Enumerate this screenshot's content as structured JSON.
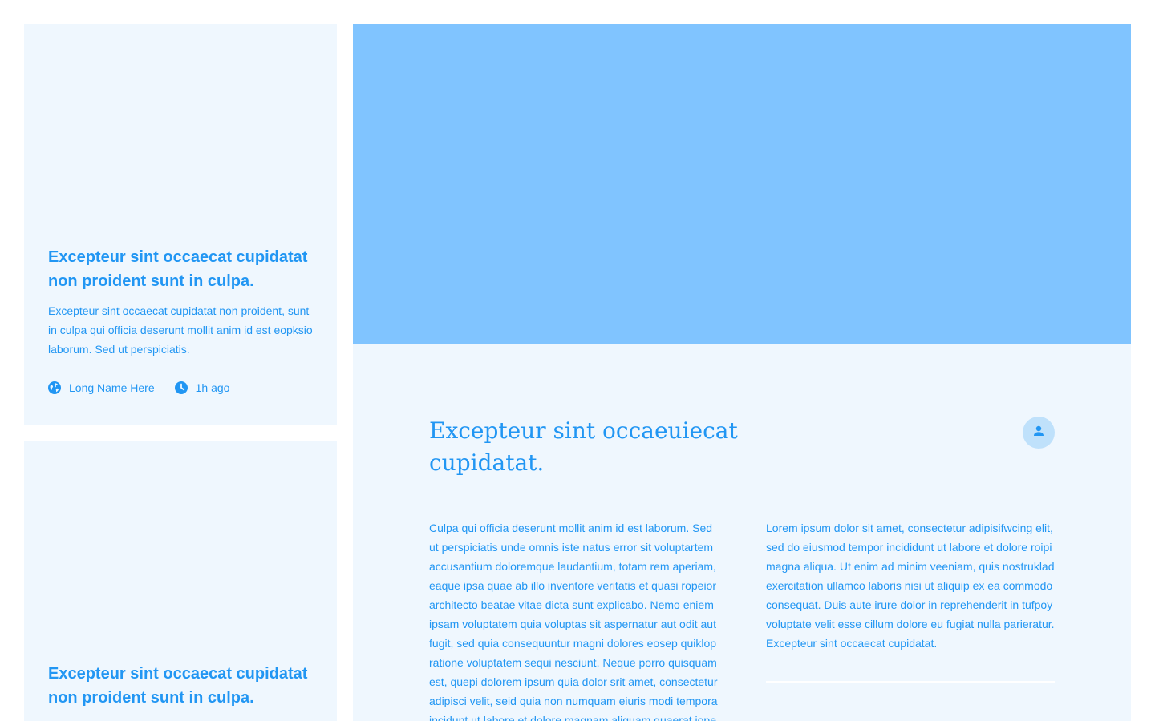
{
  "cards": [
    {
      "title": "Excepteur sint occaecat cupidatat non proident sunt in culpa.",
      "excerpt": "Excepteur sint occaecat cupidatat non proident, sunt in culpa qui officia deserunt mollit anim id est eopksio laborum. Sed ut perspiciatis.",
      "author": "Long Name Here",
      "time": "1h ago",
      "author_icon": "globe-icon",
      "time_icon": "clock-icon"
    },
    {
      "title": "Excepteur sint occaecat cupidatat non proident sunt in culpa."
    }
  ],
  "article": {
    "title": "Excepteur sint occaeuiecat cupidatat.",
    "avatar_icon": "person-icon",
    "body_left": "Culpa qui officia deserunt mollit anim id est laborum. Sed ut perspiciatis unde omnis iste natus error sit voluptartem accusantium doloremque laudantium, totam rem aperiam, eaque ipsa quae ab illo inventore veritatis et quasi ropeior architecto beatae vitae dicta sunt explicabo. Nemo eniem ipsam voluptatem quia voluptas sit aspernatur aut odit aut fugit, sed quia consequuntur magni dolores eosep quiklop ratione voluptatem sequi nesciunt. Neque porro quisquam est, quepi dolorem ipsum quia dolor srit amet, consectetur adipisci velit, seid quia non numquam eiuris modi tempora incidunt ut labore et dolore magnam aliquam quaerat iope",
    "body_right": "Lorem ipsum dolor sit amet, consectetur adipisifwcing elit, sed do eiusmod tempor incididunt ut labore et dolore roipi magna aliqua. Ut enim ad minim veeniam, quis nostruklad exercitation ullamco laboris nisi ut aliquip ex ea commodo consequat. Duis aute irure dolor in reprehenderit in tufpoy voluptate velit esse cillum dolore eu fugiat nulla parieratur. Excepteur sint occaecat cupidatat."
  },
  "colors": {
    "accent": "#2196f3",
    "card_bg": "#eff7fe",
    "hero_bg": "#80c4ff",
    "avatar_bg": "#bfe1fb"
  }
}
